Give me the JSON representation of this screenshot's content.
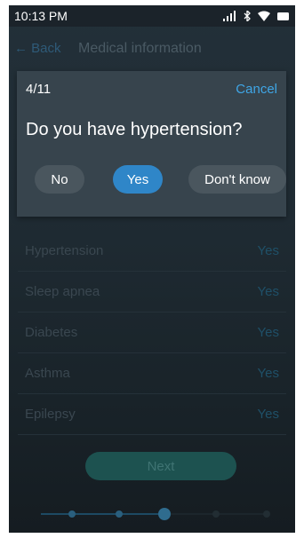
{
  "status_bar": {
    "time": "10:13 PM"
  },
  "nav": {
    "back_label": "← Back",
    "title": "Medical information"
  },
  "question_card": {
    "counter": "4/11",
    "cancel_label": "Cancel",
    "question": "Do you have hypertension?",
    "answers": [
      "No",
      "Yes",
      "Don't know"
    ],
    "selected_answer": "Yes"
  },
  "answers_list": [
    {
      "label": "Hypertension",
      "value": "Yes"
    },
    {
      "label": "Sleep apnea",
      "value": "Yes"
    },
    {
      "label": "Diabetes",
      "value": "Yes"
    },
    {
      "label": "Asthma",
      "value": "Yes"
    },
    {
      "label": "Epilepsy",
      "value": "Yes"
    }
  ],
  "next_label": "Next",
  "progress": {
    "steps": 5,
    "current_step": 3
  },
  "colors": {
    "accent": "#2f86c8",
    "cancel": "#3fa6e6",
    "card": "#37444d",
    "background": "#1f2b33"
  },
  "icons": {
    "signal": "signal-icon",
    "bluetooth": "bluetooth-icon",
    "wifi": "wifi-icon",
    "battery": "battery-icon"
  }
}
